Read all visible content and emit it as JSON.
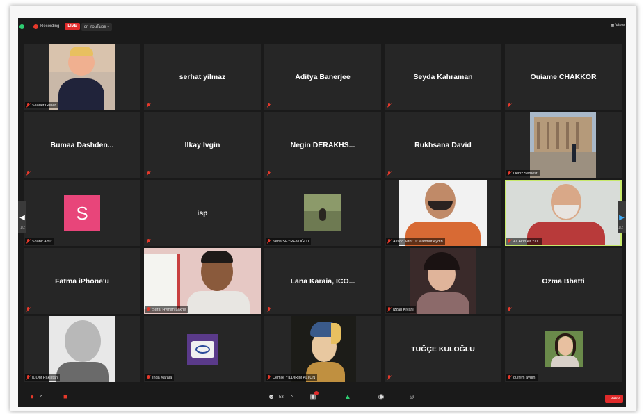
{
  "topbar": {
    "recording": "Recording",
    "live": "LIVE",
    "stream": "on YouTube ▾",
    "view": "View"
  },
  "tiles": [
    {
      "name": "Saadet Güner",
      "display": ""
    },
    {
      "name": "",
      "display": "serhat yilmaz"
    },
    {
      "name": "",
      "display": "Aditya Banerjee"
    },
    {
      "name": "",
      "display": "Seyda Kahraman"
    },
    {
      "name": "",
      "display": "Ouiame CHAKKOR"
    },
    {
      "name": "",
      "display": "Bumaa  Dashden..."
    },
    {
      "name": "",
      "display": "Ilkay Ivgin"
    },
    {
      "name": "",
      "display": "Negin  DERAKHS..."
    },
    {
      "name": "",
      "display": "Rukhsana David"
    },
    {
      "name": "Deniz Serbest",
      "display": ""
    },
    {
      "name": "Shabir Amir",
      "display": "",
      "avatar": "S"
    },
    {
      "name": "",
      "display": "isp"
    },
    {
      "name": "Seda SEYREKOĞLU",
      "display": ""
    },
    {
      "name": "Assoc. Prof.Dr.Mahmut Aydın",
      "display": ""
    },
    {
      "name": "Ali Akın AKYOL",
      "display": ""
    },
    {
      "name": "",
      "display": "Fatma iPhone'u"
    },
    {
      "name": "Suraj Hyman Lakhe",
      "display": ""
    },
    {
      "name": "",
      "display": "Lana Karaia, ICO..."
    },
    {
      "name": "Izzah Kiyani",
      "display": ""
    },
    {
      "name": "",
      "display": "Ozma Bhatti"
    },
    {
      "name": "ICOM Pakistan",
      "display": ""
    },
    {
      "name": "Inga Karaia",
      "display": ""
    },
    {
      "name": "Cemile YILDIRIM ALTUN",
      "display": ""
    },
    {
      "name": "",
      "display": "TUĞÇE KULOĞLU"
    },
    {
      "name": "gülfem aydın",
      "display": ""
    }
  ],
  "pages": {
    "left": "1/2",
    "right": "1/2"
  },
  "bottombar": {
    "participants": "53",
    "leave": "Leave"
  },
  "colors": {
    "live": "#e02a2a",
    "active_border": "#c7e96b",
    "avatar": "#e8457a"
  }
}
